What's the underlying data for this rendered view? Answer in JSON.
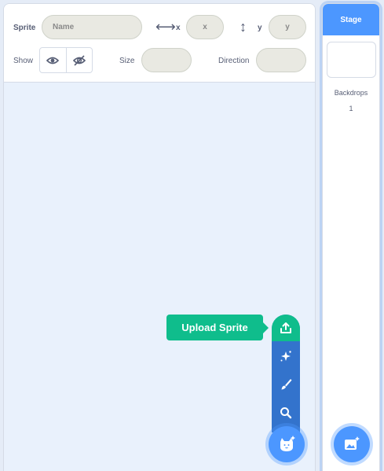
{
  "sprite_info": {
    "sprite_label": "Sprite",
    "name_placeholder": "Name",
    "x_label": "x",
    "x_placeholder": "x",
    "y_label": "y",
    "y_placeholder": "y",
    "show_label": "Show",
    "size_label": "Size",
    "direction_label": "Direction"
  },
  "stage": {
    "header": "Stage",
    "backdrops_label": "Backdrops",
    "backdrops_count": "1"
  },
  "sprite_menu": {
    "tooltip": "Upload Sprite",
    "items": [
      "upload-icon",
      "surprise-icon",
      "paint-icon",
      "search-icon"
    ]
  },
  "colors": {
    "accent": "#4c97ff",
    "menu": "#3373cc",
    "active": "#0fbd8c"
  }
}
